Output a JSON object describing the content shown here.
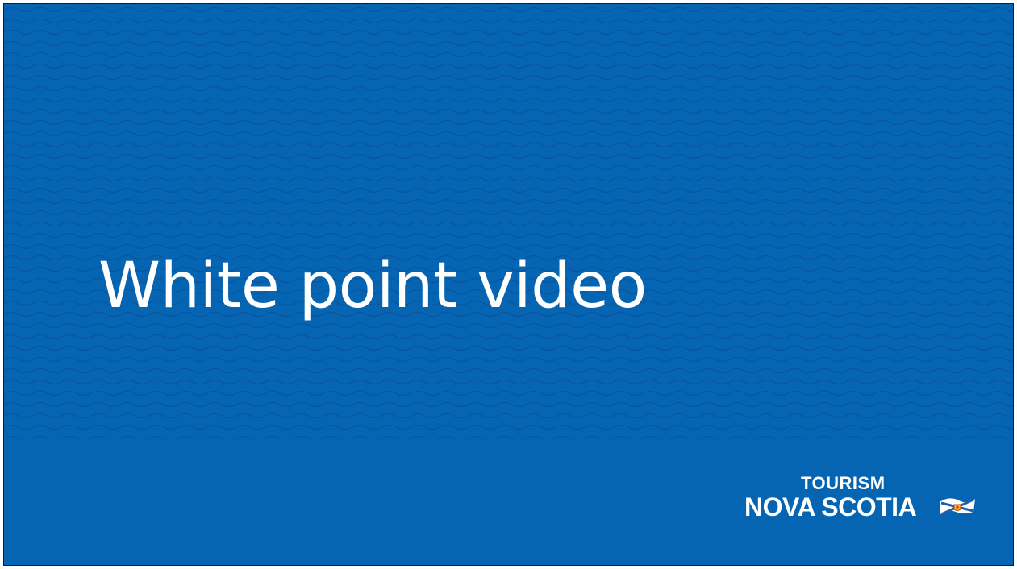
{
  "slide": {
    "title": "White point video",
    "background_color": "#0565b3",
    "title_color": "#ffffff"
  },
  "logo": {
    "line1": "TOURISM",
    "line2": "NOVA SCOTIA",
    "icon": "nova-scotia-flag-icon"
  }
}
